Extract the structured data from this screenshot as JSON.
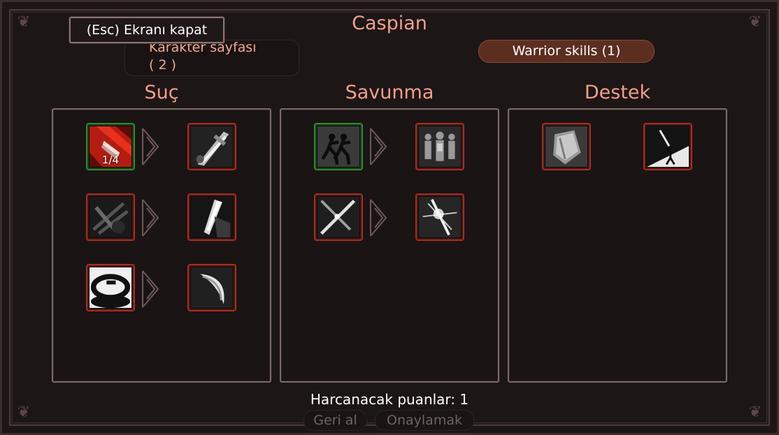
{
  "window": {
    "title": "Caspian",
    "close_label": "(Esc) Ekranı kapat"
  },
  "tabs": {
    "character_page_line1": "Karakter sayfası",
    "character_page_line2": "( 2 )",
    "warrior_skills": "Warrior skills (1)"
  },
  "columns": [
    {
      "title": "Suç",
      "skills": [
        {
          "icon": "red-blade-strike-icon",
          "state": "learned",
          "rank": "1/4"
        },
        {
          "icon": "sword-slash-icon",
          "state": "locked"
        },
        {
          "icon": "crossed-blades-icon",
          "state": "locked"
        },
        {
          "icon": "blade-edge-icon",
          "state": "locked"
        },
        {
          "icon": "whirlwind-spin-icon",
          "state": "locked"
        },
        {
          "icon": "crescent-slash-icon",
          "state": "locked"
        }
      ]
    },
    {
      "title": "Savunma",
      "skills": [
        {
          "icon": "shadow-runners-icon",
          "state": "available"
        },
        {
          "icon": "soldier-formation-icon",
          "state": "locked"
        },
        {
          "icon": "crossed-swords-icon",
          "state": "locked"
        },
        {
          "icon": "light-burst-sword-icon",
          "state": "locked"
        }
      ]
    },
    {
      "title": "Destek",
      "skills": [
        {
          "icon": "shield-icon",
          "state": "locked"
        },
        {
          "icon": "warrior-raising-sword-icon",
          "state": "locked"
        }
      ]
    }
  ],
  "footer": {
    "points_label": "Harcanacak puanlar: 1",
    "undo_label": "Geri al",
    "confirm_label": "Onaylamak"
  },
  "colors": {
    "background": "#1d1616",
    "accent_title": "#f0a08a",
    "skill_border_locked": "#b02a20",
    "skill_border_learned": "#2e8a2e",
    "active_tab": "#5c2e20"
  }
}
